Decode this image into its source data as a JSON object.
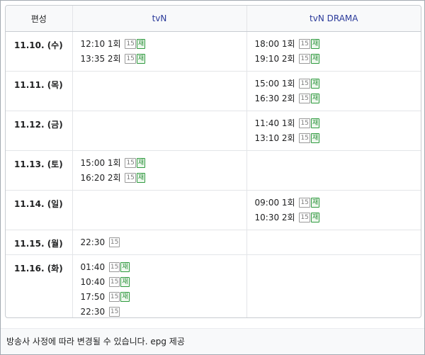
{
  "headers": {
    "date": "편성",
    "tvn": "tvN",
    "drama": "tvN DRAMA"
  },
  "rows": [
    {
      "date": "11.10. (수)",
      "tvn": [
        {
          "time": "12:10",
          "ep": "1회",
          "rating": "15",
          "rerun": "재"
        },
        {
          "time": "13:35",
          "ep": "2회",
          "rating": "15",
          "rerun": "재"
        }
      ],
      "drama": [
        {
          "time": "18:00",
          "ep": "1회",
          "rating": "15",
          "rerun": "재"
        },
        {
          "time": "19:10",
          "ep": "2회",
          "rating": "15",
          "rerun": "재"
        }
      ]
    },
    {
      "date": "11.11. (목)",
      "tvn": [],
      "drama": [
        {
          "time": "15:00",
          "ep": "1회",
          "rating": "15",
          "rerun": "재"
        },
        {
          "time": "16:30",
          "ep": "2회",
          "rating": "15",
          "rerun": "재"
        }
      ]
    },
    {
      "date": "11.12. (금)",
      "tvn": [],
      "drama": [
        {
          "time": "11:40",
          "ep": "1회",
          "rating": "15",
          "rerun": "재"
        },
        {
          "time": "13:10",
          "ep": "2회",
          "rating": "15",
          "rerun": "재"
        }
      ]
    },
    {
      "date": "11.13. (토)",
      "tvn": [
        {
          "time": "15:00",
          "ep": "1회",
          "rating": "15",
          "rerun": "재"
        },
        {
          "time": "16:20",
          "ep": "2회",
          "rating": "15",
          "rerun": "재"
        }
      ],
      "drama": []
    },
    {
      "date": "11.14. (일)",
      "tvn": [],
      "drama": [
        {
          "time": "09:00",
          "ep": "1회",
          "rating": "15",
          "rerun": "재"
        },
        {
          "time": "10:30",
          "ep": "2회",
          "rating": "15",
          "rerun": "재"
        }
      ]
    },
    {
      "date": "11.15. (월)",
      "tvn": [
        {
          "time": "22:30",
          "ep": "",
          "rating": "15",
          "rerun": ""
        }
      ],
      "drama": []
    },
    {
      "date": "11.16. (화)",
      "tvn": [
        {
          "time": "01:40",
          "ep": "",
          "rating": "15",
          "rerun": "재"
        },
        {
          "time": "10:40",
          "ep": "",
          "rating": "15",
          "rerun": "재"
        },
        {
          "time": "17:50",
          "ep": "",
          "rating": "15",
          "rerun": "재"
        },
        {
          "time": "22:30",
          "ep": "",
          "rating": "15",
          "rerun": ""
        }
      ],
      "drama": []
    }
  ],
  "footer": {
    "note": "방송사 사정에 따라 변경될 수 있습니다.",
    "source": "epg 제공"
  }
}
